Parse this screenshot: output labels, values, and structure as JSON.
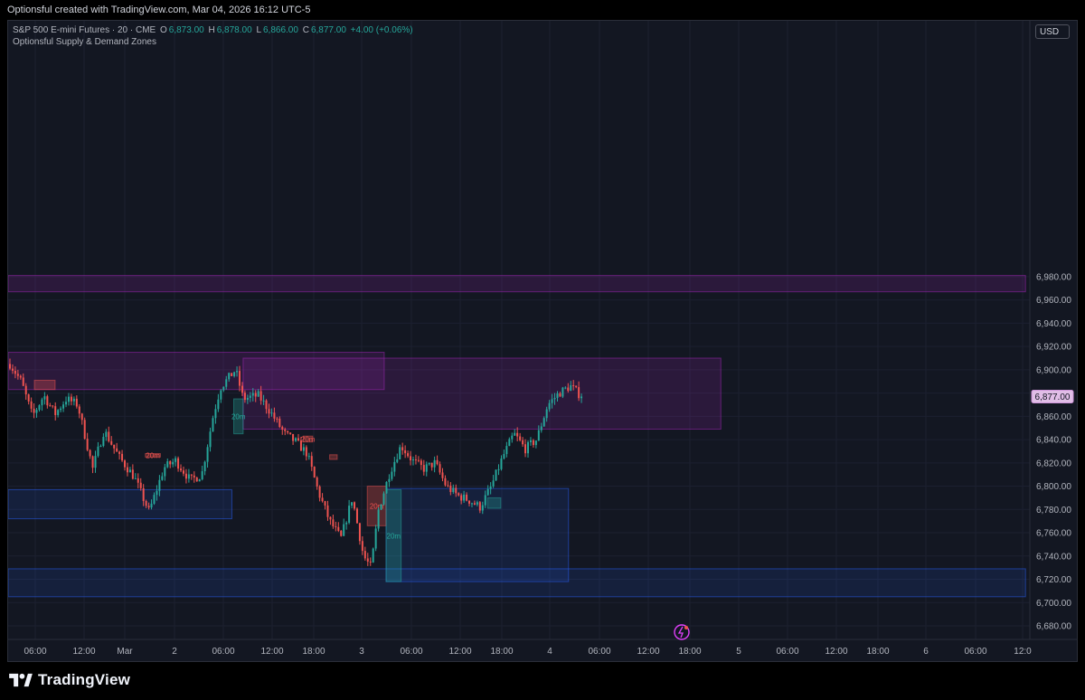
{
  "header": {
    "caption": "Optionsful created with TradingView.com, Mar 04, 2026 16:12 UTC-5"
  },
  "legend": {
    "symbol": "S&P 500 E-mini Futures · 20 · CME",
    "o_label": "O",
    "o_value": "6,873.00",
    "h_label": "H",
    "h_value": "6,878.00",
    "l_label": "L",
    "l_value": "6,866.00",
    "c_label": "C",
    "c_value": "6,877.00",
    "change": "+4.00 (+0.06%)",
    "indicator": "Optionsful Supply & Demand Zones"
  },
  "price_scale": {
    "currency": "USD",
    "last_price_label": "6,877.00"
  },
  "footer": {
    "brand": "TradingView"
  },
  "colors": {
    "up": "#26a69a",
    "down": "#ef5350",
    "supply": "#9c27b0",
    "demand": "#2962ff",
    "background": "#131722"
  },
  "chart_data": {
    "type": "candlestick",
    "title": "S&P 500 E-mini Futures · 20 · CME",
    "ylim": [
      6670,
      6990
    ],
    "y_ticks": [
      6680,
      6700,
      6720,
      6740,
      6760,
      6780,
      6800,
      6820,
      6840,
      6860,
      6880,
      6900,
      6920,
      6940,
      6960,
      6980
    ],
    "y_tick_labels": [
      "6,680.00",
      "6,700.00",
      "6,720.00",
      "6,740.00",
      "6,760.00",
      "6,780.00",
      "6,800.00",
      "6,820.00",
      "6,840.00",
      "6,860.00",
      "6,880.00",
      "6,900.00",
      "6,920.00",
      "6,940.00",
      "6,960.00",
      "6,980.00"
    ],
    "x_tick_labels": [
      "06:00",
      "12:00",
      "Mar",
      "2",
      "06:00",
      "12:00",
      "18:00",
      "3",
      "06:00",
      "12:00",
      "18:00",
      "4",
      "06:00",
      "12:00",
      "18:00",
      "5",
      "06:00",
      "12:00",
      "18:00",
      "6",
      "06:00",
      "12:0"
    ],
    "last_close": 6877,
    "close_path": [
      [
        0,
        6905
      ],
      [
        0.06,
        6890
      ],
      [
        0.12,
        6860
      ],
      [
        0.18,
        6878
      ],
      [
        0.24,
        6862
      ],
      [
        0.3,
        6875
      ],
      [
        0.36,
        6870
      ],
      [
        0.44,
        6815
      ],
      [
        0.5,
        6848
      ],
      [
        0.58,
        6825
      ],
      [
        0.66,
        6808
      ],
      [
        0.74,
        6778
      ],
      [
        0.82,
        6816
      ],
      [
        0.88,
        6822
      ],
      [
        0.96,
        6805
      ],
      [
        1.02,
        6810
      ],
      [
        1.08,
        6860
      ],
      [
        1.12,
        6885
      ],
      [
        1.2,
        6900
      ],
      [
        1.24,
        6875
      ],
      [
        1.32,
        6878
      ],
      [
        1.38,
        6865
      ],
      [
        1.46,
        6845
      ],
      [
        1.52,
        6838
      ],
      [
        1.58,
        6828
      ],
      [
        1.64,
        6795
      ],
      [
        1.7,
        6770
      ],
      [
        1.76,
        6755
      ],
      [
        1.82,
        6790
      ],
      [
        1.88,
        6740
      ],
      [
        1.92,
        6730
      ],
      [
        1.96,
        6780
      ],
      [
        2.02,
        6812
      ],
      [
        2.08,
        6835
      ],
      [
        2.14,
        6822
      ],
      [
        2.2,
        6815
      ],
      [
        2.26,
        6820
      ],
      [
        2.32,
        6800
      ],
      [
        2.38,
        6792
      ],
      [
        2.44,
        6788
      ],
      [
        2.5,
        6782
      ],
      [
        2.56,
        6800
      ],
      [
        2.62,
        6825
      ],
      [
        2.68,
        6845
      ],
      [
        2.74,
        6832
      ],
      [
        2.8,
        6840
      ],
      [
        2.86,
        6870
      ],
      [
        2.92,
        6880
      ],
      [
        2.98,
        6886
      ],
      [
        3.04,
        6877
      ]
    ],
    "supply_zones": [
      {
        "from": 6967,
        "to": 6981,
        "x0": -0.1,
        "x1": 5.4
      },
      {
        "from": 6883,
        "to": 6915,
        "x0": -0.1,
        "x1": 1.99
      },
      {
        "from": 6849,
        "to": 6910,
        "x0": 1.24,
        "x1": 3.78
      }
    ],
    "demand_zones": [
      {
        "from": 6772,
        "to": 6797,
        "x0": -0.1,
        "x1": 1.18
      },
      {
        "from": 6718,
        "to": 6798,
        "x0": 2.0,
        "x1": 2.97
      },
      {
        "from": 6705,
        "to": 6729,
        "x0": -0.1,
        "x1": 5.4
      }
    ],
    "markers": [
      {
        "kind": "down",
        "label": "",
        "x0": 0.13,
        "x1": 0.24,
        "from": 6883,
        "to": 6891
      },
      {
        "kind": "up",
        "label": "20m",
        "x0": 1.19,
        "x1": 1.24,
        "from": 6845,
        "to": 6875
      },
      {
        "kind": "down",
        "label": "20m",
        "x0": 0.72,
        "x1": 0.8,
        "from": 6825,
        "to": 6828
      },
      {
        "kind": "down",
        "label": "20m",
        "x0": 1.56,
        "x1": 1.61,
        "from": 6838,
        "to": 6843
      },
      {
        "kind": "down",
        "label": "",
        "x0": 1.7,
        "x1": 1.74,
        "from": 6823,
        "to": 6827
      },
      {
        "kind": "down",
        "label": "20m",
        "x0": 1.9,
        "x1": 2.0,
        "from": 6766,
        "to": 6800
      },
      {
        "kind": "up",
        "label": "20m",
        "x0": 2.0,
        "x1": 2.08,
        "from": 6718,
        "to": 6797
      },
      {
        "kind": "up",
        "label": "",
        "x0": 2.54,
        "x1": 2.61,
        "from": 6781,
        "to": 6790
      }
    ]
  }
}
